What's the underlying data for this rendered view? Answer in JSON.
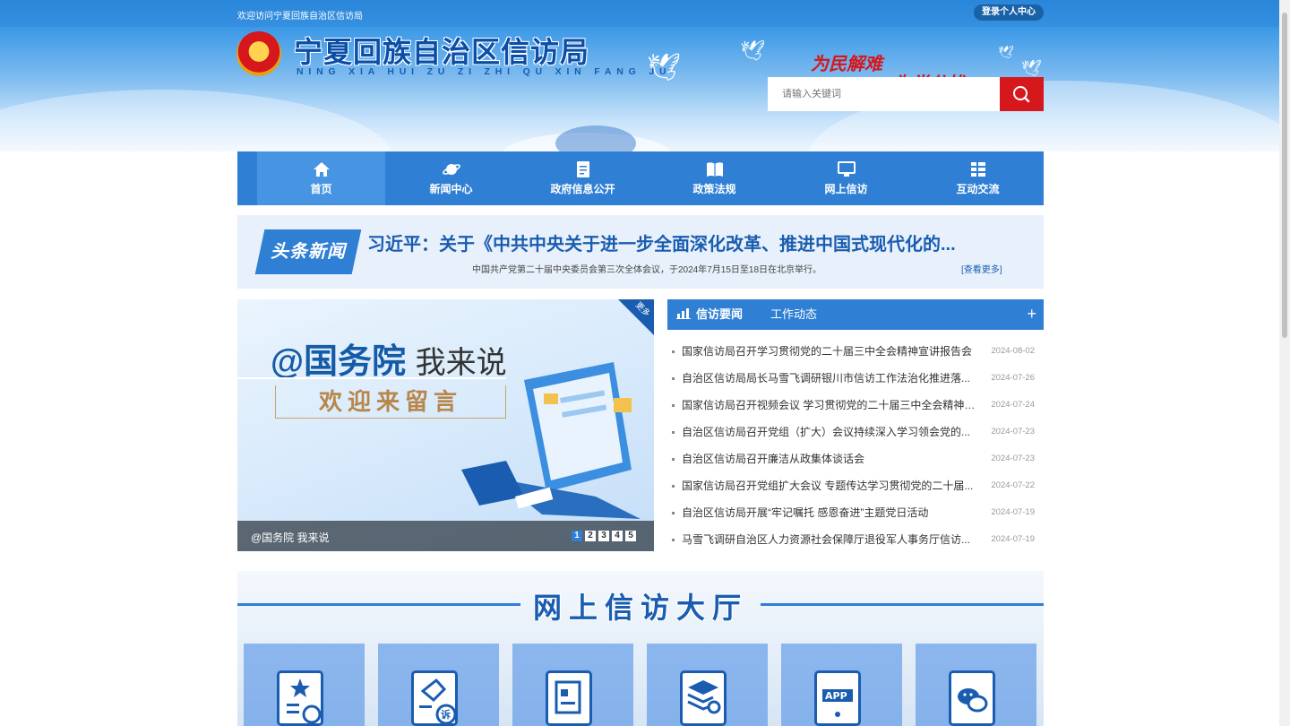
{
  "topbar": {
    "welcome": "欢迎访问宁夏回族自治区信访局",
    "login": "登录个人中心"
  },
  "header": {
    "title": "宁夏回族自治区信访局",
    "pinyin": "NING XIA HUI ZU ZI ZHI QU XIN FANG JU",
    "slogan_1": "为民解难",
    "slogan_2": "为党分忧",
    "search_placeholder": "请输入关键词"
  },
  "nav": [
    {
      "label": "首页",
      "icon": "home-icon"
    },
    {
      "label": "新闻中心",
      "icon": "planet-icon"
    },
    {
      "label": "政府信息公开",
      "icon": "document-icon"
    },
    {
      "label": "政策法规",
      "icon": "book-icon"
    },
    {
      "label": "网上信访",
      "icon": "monitor-icon"
    },
    {
      "label": "互动交流",
      "icon": "grid-icon"
    }
  ],
  "headline": {
    "badge": "头条新闻",
    "title": "习近平：关于《中共中央关于进一步全面深化改革、推进中国式现代化的...",
    "subtitle": "中国共产党第二十届中央委员会第三次全体会议，于2024年7月15日至18日在北京举行。",
    "more": "[查看更多]"
  },
  "slider": {
    "heading_1": "@国务院",
    "heading_2": "我来说",
    "box_text": "欢迎来留言",
    "corner": "更多",
    "caption": "@国务院 我来说",
    "pages": [
      "1",
      "2",
      "3",
      "4",
      "5"
    ]
  },
  "news": {
    "tab_active": "信访要闻",
    "tab_other": "工作动态",
    "more_symbol": "+",
    "items": [
      {
        "title": "国家信访局召开学习贯彻党的二十届三中全会精神宣讲报告会",
        "date": "2024-08-02"
      },
      {
        "title": "自治区信访局局长马雪飞调研银川市信访工作法治化推进落...",
        "date": "2024-07-26"
      },
      {
        "title": "国家信访局召开视频会议 学习贯彻党的二十届三中全会精神 ...",
        "date": "2024-07-24"
      },
      {
        "title": "自治区信访局召开党组（扩大）会议持续深入学习领会党的...",
        "date": "2024-07-23"
      },
      {
        "title": "自治区信访局召开廉洁从政集体谈话会",
        "date": "2024-07-23"
      },
      {
        "title": "国家信访局召开党组扩大会议 专题传达学习贯彻党的二十届...",
        "date": "2024-07-22"
      },
      {
        "title": "自治区信访局开展“牢记嘱托 感恩奋进”主题党日活动",
        "date": "2024-07-19"
      },
      {
        "title": "马雪飞调研自治区人力资源社会保障厅退役军人事务厅信访...",
        "date": "2024-07-19"
      }
    ]
  },
  "hall": {
    "title": "网上信访大厅"
  },
  "colors": {
    "primary": "#2f7fd4",
    "accent_red": "#d6171c",
    "dark_blue": "#1a5db0"
  }
}
